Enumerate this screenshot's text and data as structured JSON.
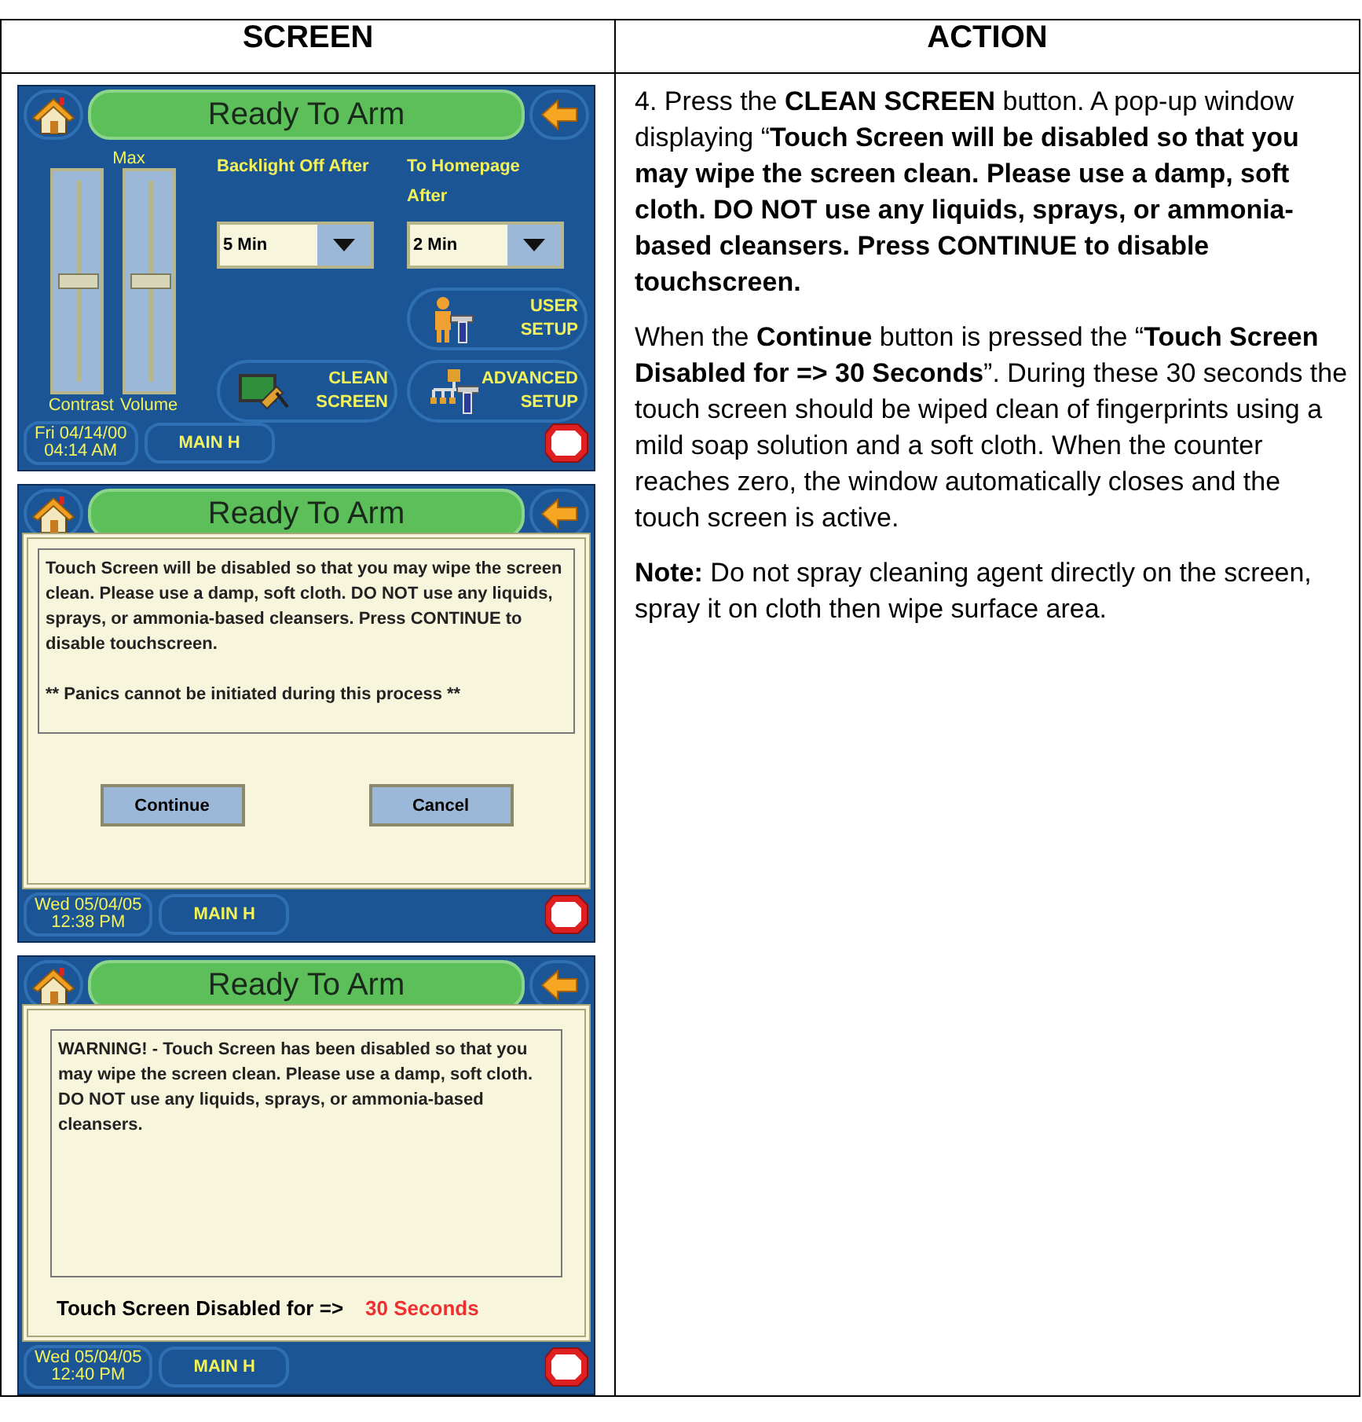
{
  "table": {
    "columns": [
      "SCREEN",
      "ACTION"
    ]
  },
  "screens": [
    {
      "kind": "settings",
      "title": "Ready To Arm",
      "slider_max": "Max",
      "sliders": [
        {
          "label": "Contrast",
          "level": 0.5
        },
        {
          "label": "Volume",
          "level": 0.5
        }
      ],
      "dropdowns": [
        {
          "label": "Backlight Off After",
          "value": "5 Min"
        },
        {
          "label": "To Homepage After",
          "value": "2 Min"
        }
      ],
      "buttons": [
        {
          "kind": "user",
          "label": "USER SETUP"
        },
        {
          "kind": "clean",
          "label": "CLEAN SCREEN"
        },
        {
          "kind": "advanced",
          "label": "ADVANCED SETUP"
        }
      ],
      "date": "Fri 04/14/00",
      "time": "04:14 AM",
      "tab": "MAIN H"
    },
    {
      "kind": "dialog",
      "title": "Ready To Arm",
      "message": "Touch Screen will be disabled so that you may wipe the screen clean. Please use a damp, soft cloth. DO NOT use any liquids, sprays, or ammonia-based cleansers. Press CONTINUE to disable touchscreen.",
      "note": "** Panics cannot be initiated during this process **",
      "buttons": [
        "Continue",
        "Cancel"
      ],
      "date": "Wed 05/04/05",
      "time": "12:38 PM",
      "tab": "MAIN H"
    },
    {
      "kind": "countdown",
      "title": "Ready To Arm",
      "message": "WARNING! - Touch Screen has been disabled so that you may wipe the screen clean. Please use a damp, soft cloth. DO NOT use any liquids, sprays, or ammonia-based cleansers.",
      "countdown_label": "Touch Screen Disabled for =>",
      "countdown_value": "30 Seconds",
      "date": "Wed 05/04/05",
      "time": "12:40 PM",
      "tab": "MAIN H"
    }
  ],
  "action": [
    "4. Press the **CLEAN SCREEN** button. A pop-up window displaying “**Touch Screen will be disabled so that you may wipe the screen clean. Please use a damp, soft cloth. DO NOT use any liquids, sprays, or ammonia-based cleansers. Press CONTINUE to disable touchscreen.**",
    "When the **Continue** button is pressed the “**Touch Screen Disabled for => 30 Seconds**”. During these 30 seconds the touch screen should be wiped clean of fingerprints using a mild soap solution and a soft cloth. When the counter reaches zero, the window automatically closes and the touch screen is active.",
    "**Note:** Do not spray cleaning agent directly on the screen, spray it on cloth then wipe surface area."
  ]
}
